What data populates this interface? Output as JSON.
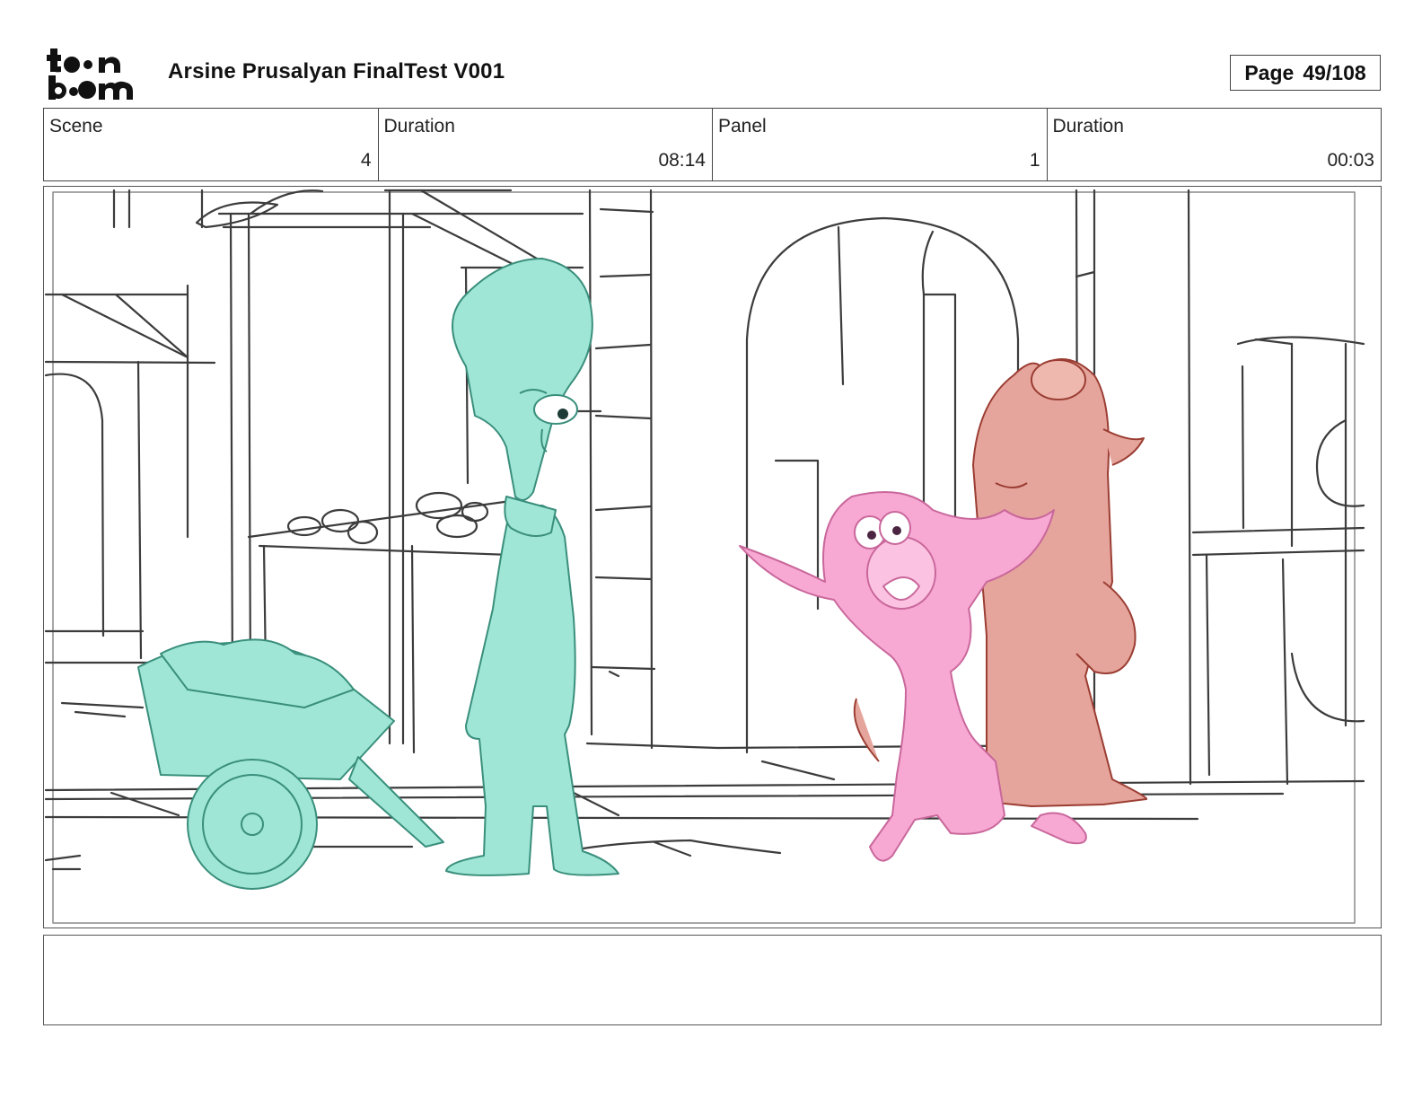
{
  "header": {
    "logo_text_line1": "toon",
    "logo_text_line2": "boom",
    "title": "Arsine Prusalyan FinalTest V001",
    "page_label": "Page",
    "page_value": "49/108"
  },
  "info": {
    "scene_label": "Scene",
    "scene_value": "4",
    "scene_duration_label": "Duration",
    "scene_duration_value": "08:14",
    "panel_label": "Panel",
    "panel_value": "1",
    "panel_duration_label": "Duration",
    "panel_duration_value": "00:03"
  },
  "colors": {
    "teal_character": "#9fe6d6",
    "teal_line": "#3a8f7c",
    "pink_character": "#f7a9d3",
    "pink_line": "#c9679b",
    "tan_character": "#e5a59c",
    "tan_line": "#9b3d33",
    "sketch_line": "#3c3c3c"
  },
  "notes": {
    "action_text": ""
  }
}
